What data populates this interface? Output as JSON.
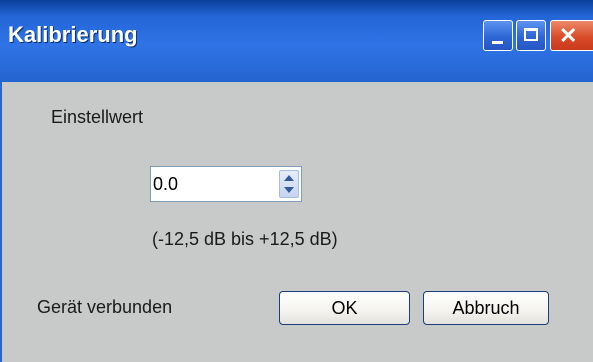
{
  "window": {
    "title": "Kalibrierung",
    "controls": {
      "minimize": "minimize",
      "maximize": "maximize",
      "close": "✕"
    }
  },
  "form": {
    "setting_label": "Einstellwert",
    "value": "0.0",
    "range_text": "(-12,5 dB bis +12,5 dB)",
    "status_text": "Gerät verbunden"
  },
  "buttons": {
    "ok_label": "OK",
    "cancel_label": "Abbruch"
  }
}
